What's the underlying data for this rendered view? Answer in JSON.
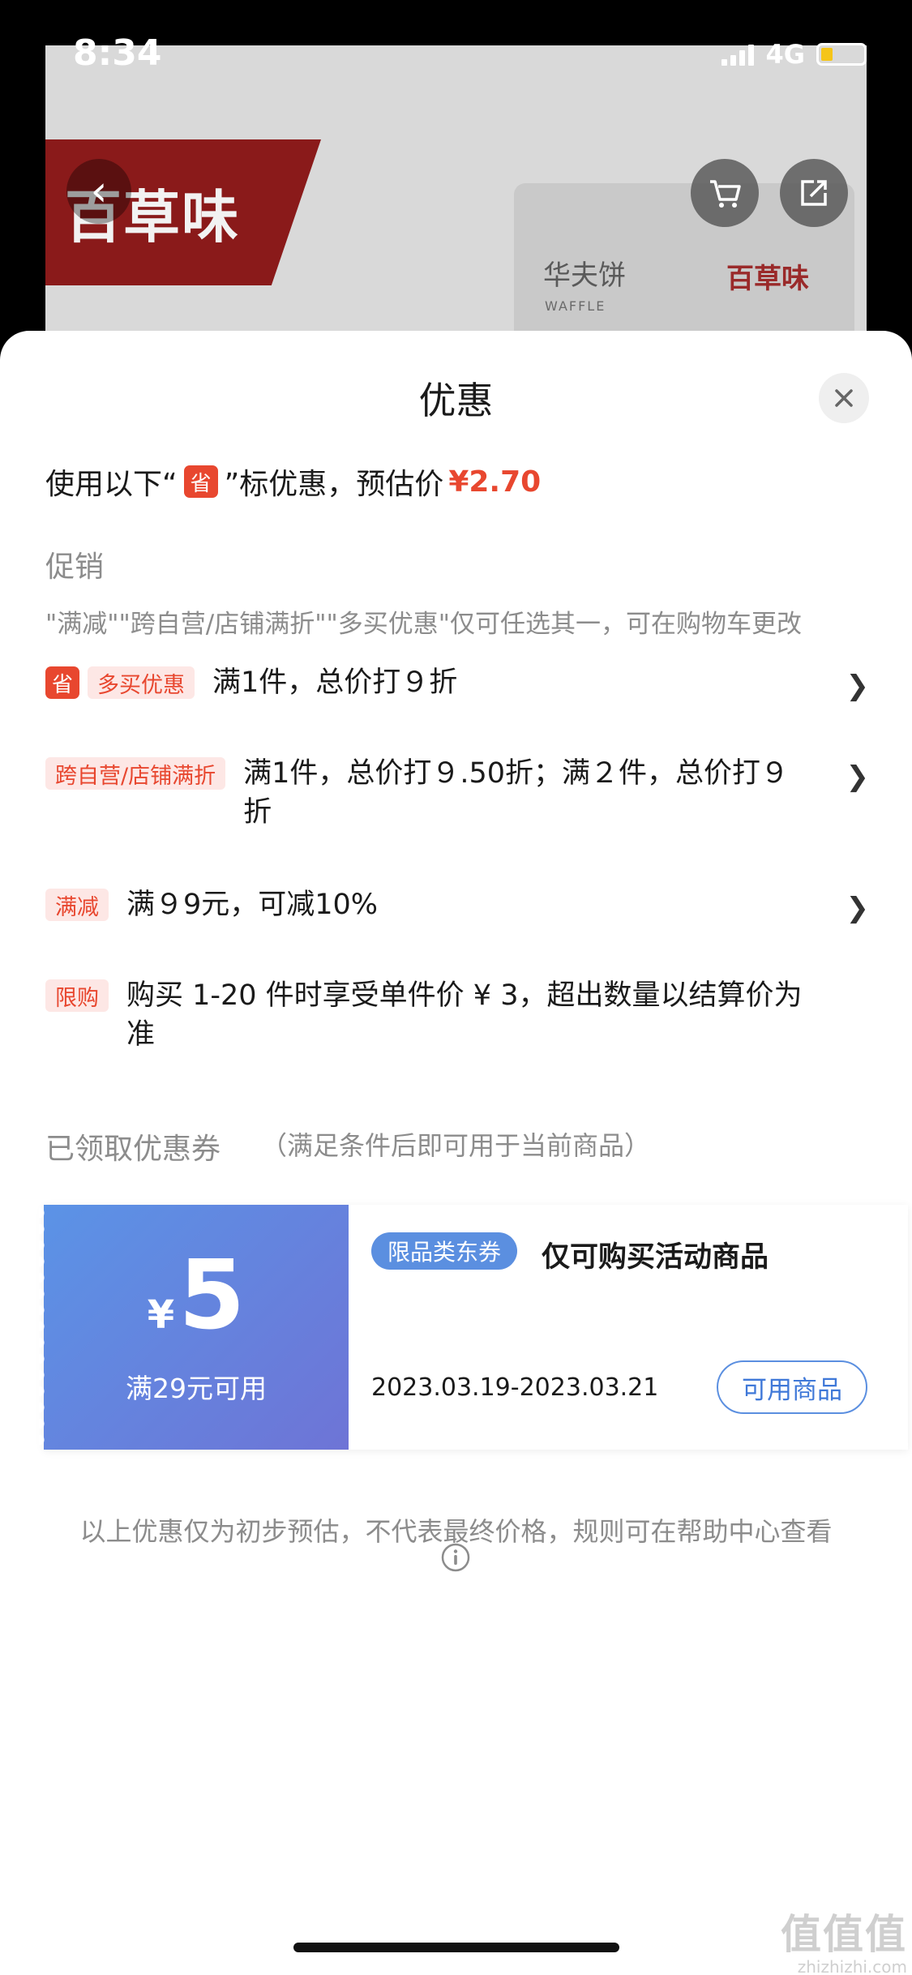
{
  "status_bar": {
    "time": "8:34",
    "network": "4G"
  },
  "background": {
    "brand_logo": "百草味",
    "product_title": "华夫饼",
    "product_brand": "百草味",
    "product_sub": "WAFFLE"
  },
  "sheet": {
    "title": "优惠",
    "summary": {
      "prefix": "使用以下“",
      "badge": "省",
      "suffix": "”标优惠，预估价",
      "price": "¥2.70"
    },
    "promo_heading": "促销",
    "promo_note": "\"满减\"\"跨自营/店铺满折\"\"多买优惠\"仅可任选其一，可在购物车更改",
    "promos": [
      {
        "badge": "省",
        "tag": "多买优惠",
        "text": "满1件，总价打９折"
      },
      {
        "tag": "跨自营/店铺满折",
        "text": "满1件，总价打９.50折；满２件，总价打９折"
      },
      {
        "tag": "满减",
        "text": "满９9元，可减10%"
      },
      {
        "tag": "限购",
        "text": "购买 1-20 件时享受单件价 ¥ 3，超出数量以结算价为准"
      }
    ],
    "coupon_heading": "已领取优惠券",
    "coupon_heading_note": "（满足条件后即可用于当前商品）",
    "coupon": {
      "currency": "¥",
      "value": "5",
      "condition": "满29元可用",
      "type": "限品类东券",
      "description": "仅可购买活动商品",
      "date": "2023.03.19-2023.03.21",
      "button": "可用商品"
    },
    "disclaimer": "以上优惠仅为初步预估，不代表最终价格，规则可在帮助中心查看"
  },
  "watermark": {
    "mark": "值值值",
    "url": "zhizhizhi.com"
  },
  "colors": {
    "accent_red": "#e8472f",
    "coupon_blue": "#5b8fe0",
    "muted_text": "#8c8c8c"
  },
  "icons": [
    "back-arrow-icon",
    "cart-icon",
    "share-icon",
    "close-icon",
    "chevron-right-icon",
    "info-icon",
    "signal-icon",
    "battery-icon"
  ]
}
